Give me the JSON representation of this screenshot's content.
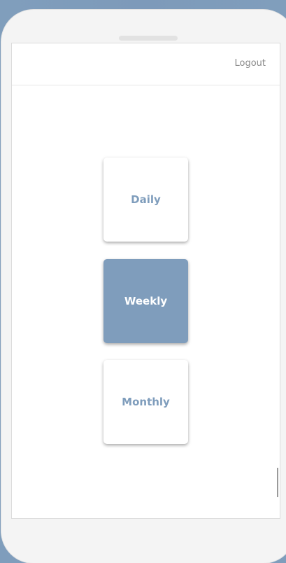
{
  "header": {
    "logout_label": "Logout"
  },
  "options": [
    {
      "label": "Daily",
      "selected": false
    },
    {
      "label": "Weekly",
      "selected": true
    },
    {
      "label": "Monthly",
      "selected": false
    }
  ],
  "colors": {
    "accent": "#7f9dbc",
    "background": "#7f9dbc",
    "card": "#ffffff"
  }
}
